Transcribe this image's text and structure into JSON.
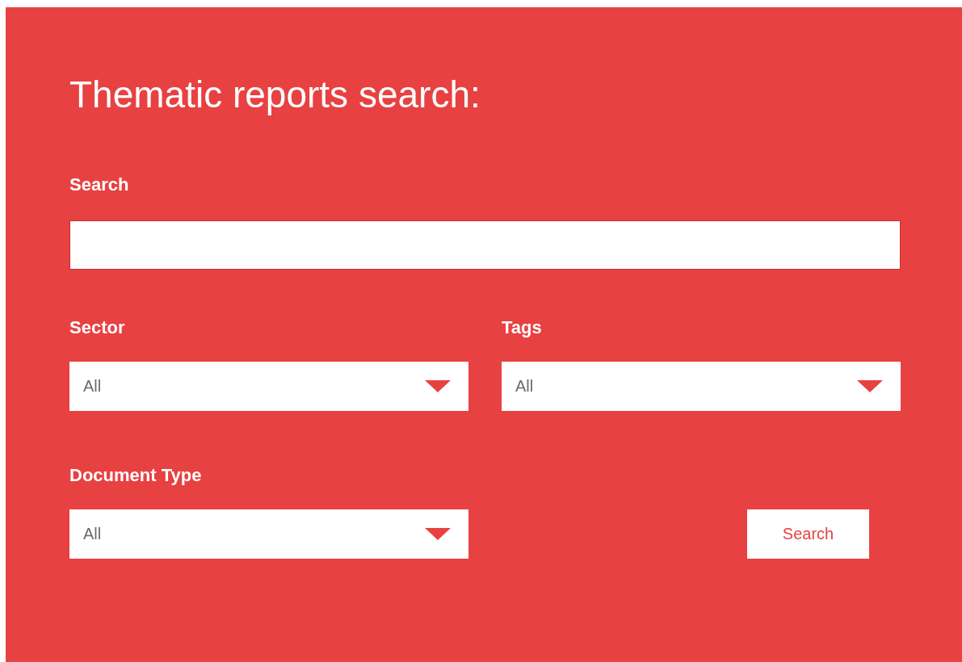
{
  "title": "Thematic reports search:",
  "search": {
    "label": "Search"
  },
  "filters": [
    {
      "label": "Sector",
      "value": "All"
    },
    {
      "label": "Tags",
      "value": "All"
    },
    {
      "label": "Document Type",
      "value": "All"
    }
  ],
  "button": {
    "label": "Search"
  }
}
